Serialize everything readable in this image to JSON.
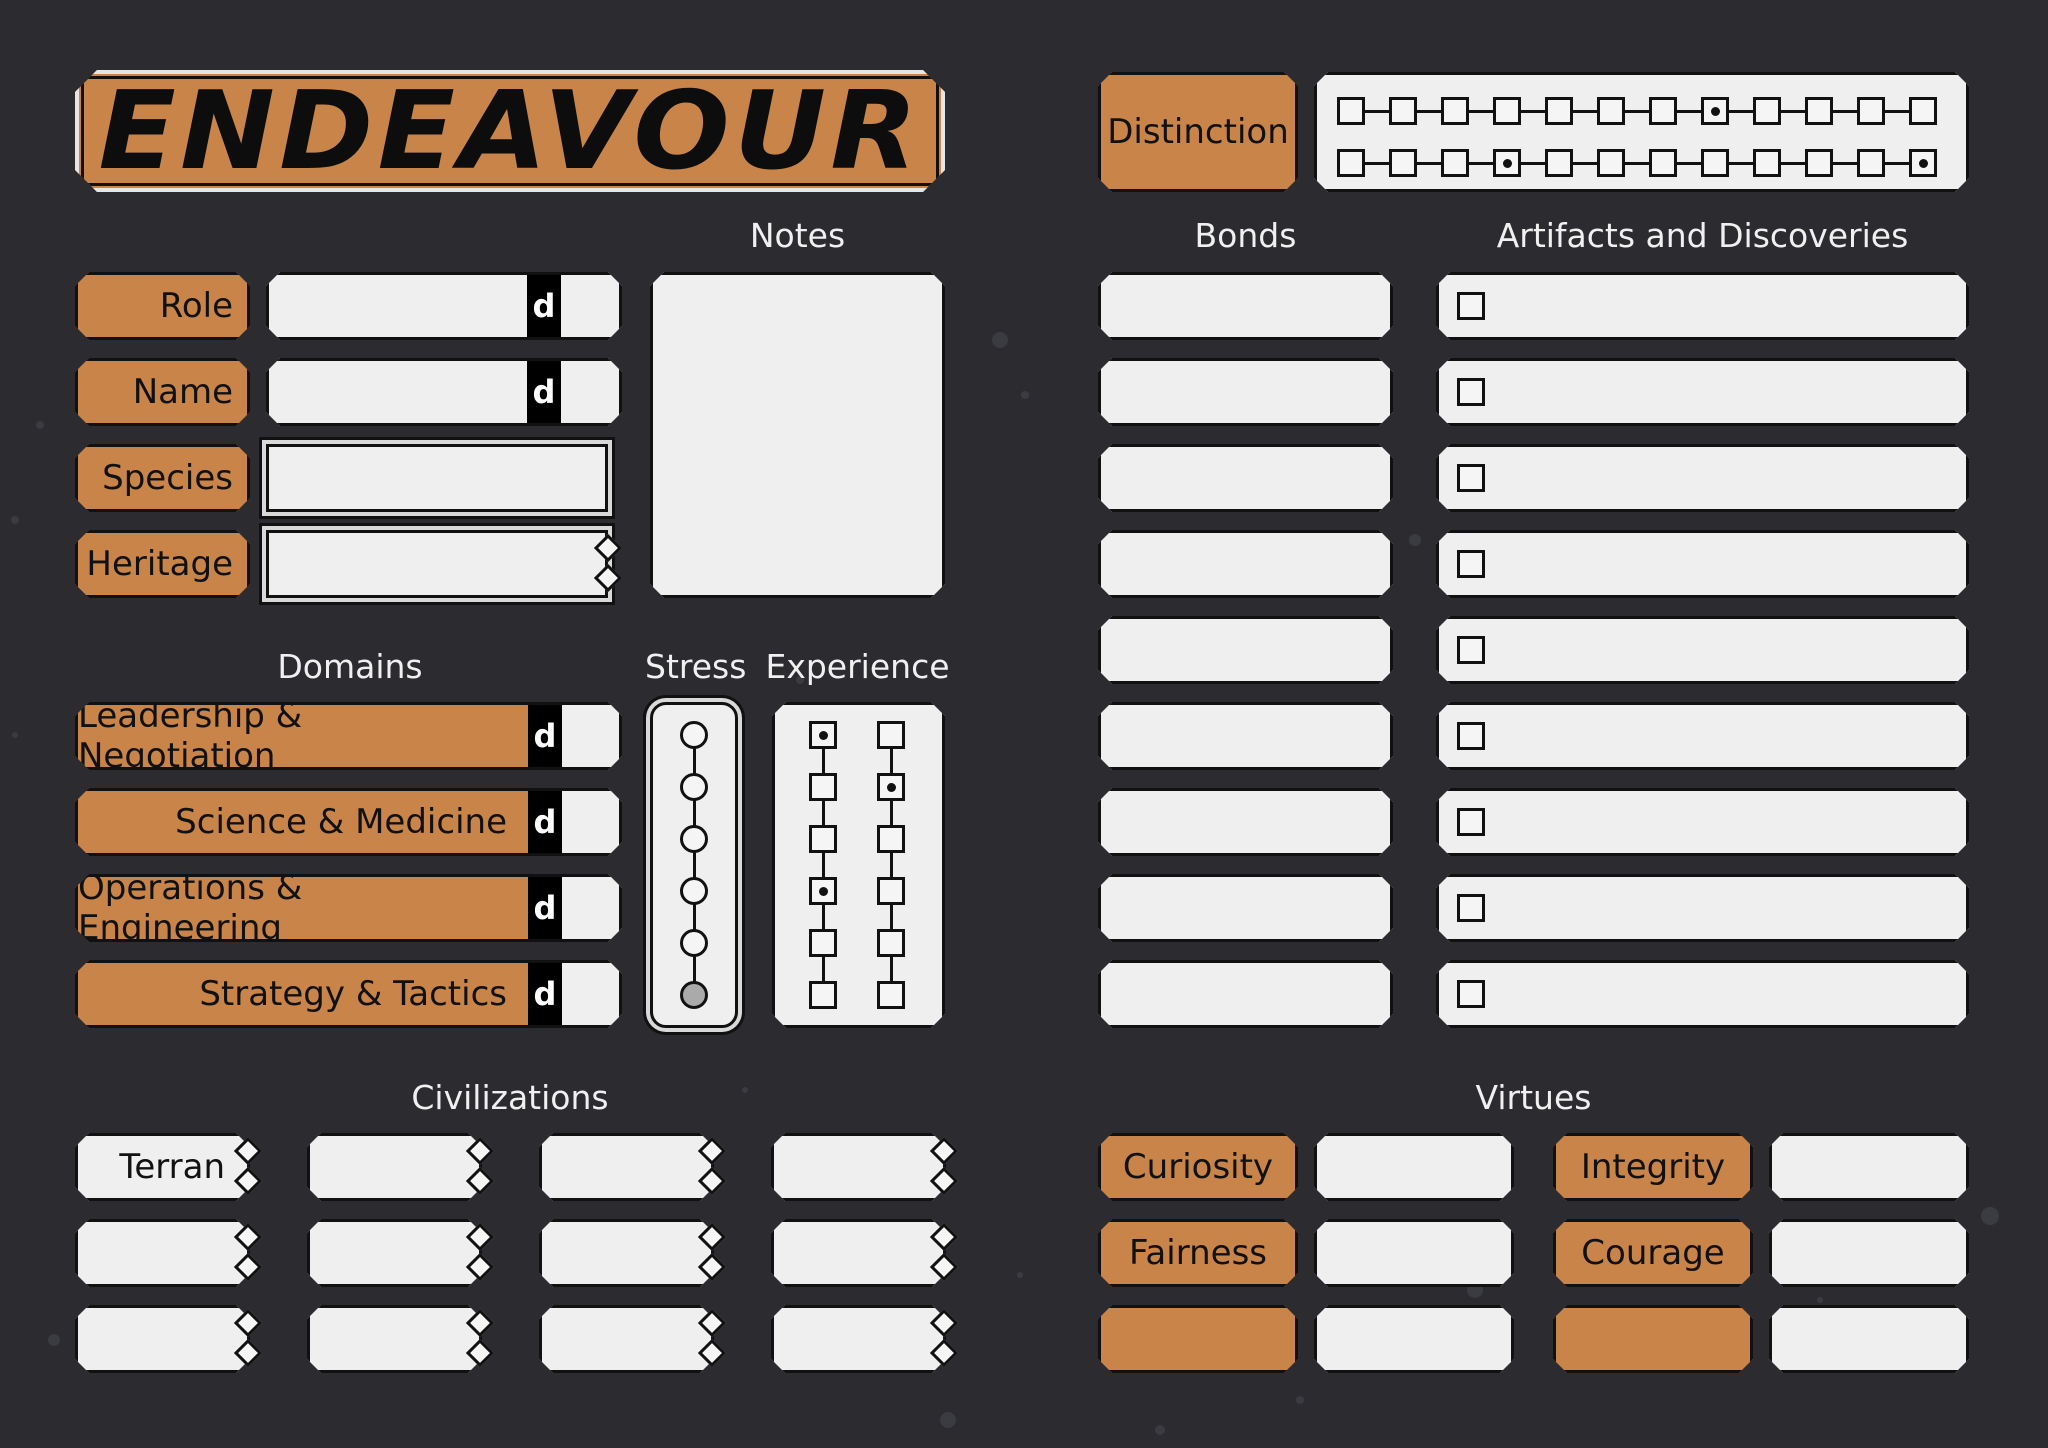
{
  "title": "ENDEAVOUR",
  "distinction": {
    "label": "Distinction",
    "track_rows": [
      [
        false,
        false,
        false,
        false,
        false,
        false,
        false,
        true,
        false,
        false,
        false,
        false
      ],
      [
        false,
        false,
        false,
        true,
        false,
        false,
        false,
        false,
        false,
        false,
        false,
        true
      ]
    ]
  },
  "headings": {
    "notes": "Notes",
    "bonds": "Bonds",
    "artifacts": "Artifacts and Discoveries",
    "domains": "Domains",
    "stress": "Stress",
    "experience": "Experience",
    "civilizations": "Civilizations",
    "virtues": "Virtues"
  },
  "identity": {
    "role": "Role",
    "name": "Name",
    "species": "Species",
    "heritage": "Heritage",
    "die_letter": "d"
  },
  "domains": [
    "Leadership & Negotiation",
    "Science & Medicine",
    "Operations & Engineering",
    "Strategy & Tactics"
  ],
  "stress": [
    false,
    false,
    false,
    false,
    false,
    true
  ],
  "experience": {
    "col1": [
      true,
      false,
      false,
      true,
      false,
      false
    ],
    "col2": [
      false,
      true,
      false,
      false,
      false,
      false
    ]
  },
  "civilizations": [
    "Terran",
    "",
    "",
    "",
    "",
    "",
    "",
    "",
    "",
    "",
    "",
    ""
  ],
  "virtues": [
    {
      "label": "Curiosity",
      "value": ""
    },
    {
      "label": "Integrity",
      "value": ""
    },
    {
      "label": "Fairness",
      "value": ""
    },
    {
      "label": "Courage",
      "value": ""
    },
    {
      "label": "",
      "value": ""
    },
    {
      "label": "",
      "value": ""
    }
  ],
  "bonds_count": 9,
  "artifacts_count": 9,
  "colors": {
    "background": "#2b2b30",
    "accent": "#c88449",
    "field": "#efefef"
  }
}
